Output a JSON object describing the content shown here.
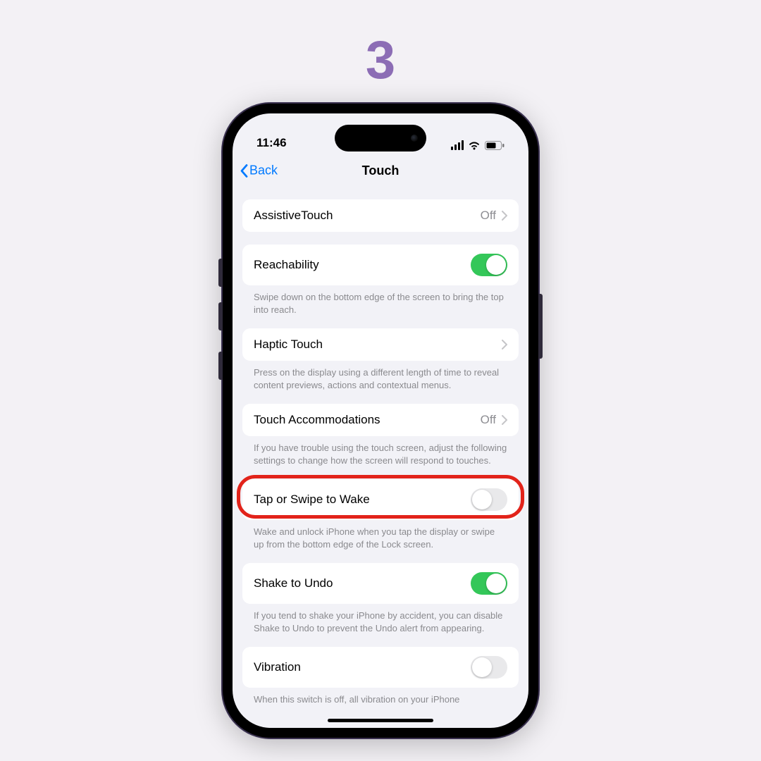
{
  "step": "3",
  "status": {
    "time": "11:46"
  },
  "nav": {
    "back": "Back",
    "title": "Touch"
  },
  "rows": {
    "assistive": {
      "label": "AssistiveTouch",
      "value": "Off"
    },
    "reachability": {
      "label": "Reachability",
      "footer": "Swipe down on the bottom edge of the screen to bring the top into reach.",
      "on": true
    },
    "haptic": {
      "label": "Haptic Touch",
      "footer": "Press on the display using a different length of time to reveal content previews, actions and contextual menus."
    },
    "accommodations": {
      "label": "Touch Accommodations",
      "value": "Off",
      "footer": "If you have trouble using the touch screen, adjust the following settings to change how the screen will respond to touches."
    },
    "tapwake": {
      "label": "Tap or Swipe to Wake",
      "footer": "Wake and unlock iPhone when you tap the display or swipe up from the bottom edge of the Lock screen.",
      "on": false
    },
    "shake": {
      "label": "Shake to Undo",
      "footer": "If you tend to shake your iPhone by accident, you can disable Shake to Undo to prevent the Undo alert from appearing.",
      "on": true
    },
    "vibration": {
      "label": "Vibration",
      "footer": "When this switch is off, all vibration on your iPhone",
      "on": false
    }
  }
}
